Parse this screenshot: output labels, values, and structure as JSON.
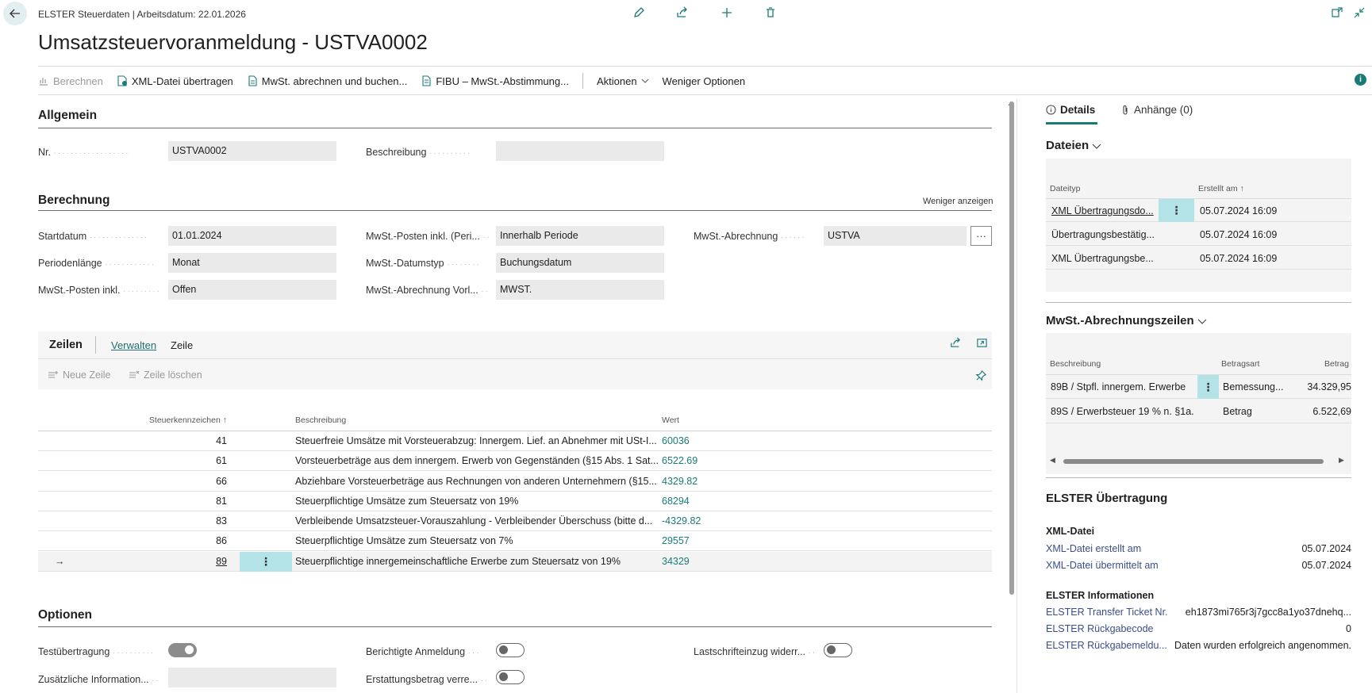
{
  "header": {
    "breadcrumb": "ELSTER Steuerdaten | Arbeitsdatum: 22.01.2026",
    "title": "Umsatzsteuervoranmeldung - USTVA0002"
  },
  "toolbar": {
    "berechnen": "Berechnen",
    "xml_uebertragen": "XML-Datei übertragen",
    "mwst_abrechnen": "MwSt. abrechnen und buchen...",
    "fibu": "FIBU – MwSt.-Abstimmung...",
    "aktionen": "Aktionen",
    "weniger_optionen": "Weniger Optionen"
  },
  "allgemein": {
    "title": "Allgemein",
    "nr_label": "Nr.",
    "nr_value": "USTVA0002",
    "beschreibung_label": "Beschreibung",
    "beschreibung_value": ""
  },
  "berechnung": {
    "title": "Berechnung",
    "weniger_anzeigen": "Weniger anzeigen",
    "startdatum_label": "Startdatum",
    "startdatum_value": "01.01.2024",
    "periodenlaenge_label": "Periodenlänge",
    "periodenlaenge_value": "Monat",
    "posten_inkl_label": "MwSt.-Posten inkl.",
    "posten_inkl_value": "Offen",
    "posten_peri_label": "MwSt.-Posten inkl. (Peri...",
    "posten_peri_value": "Innerhalb Periode",
    "datumstyp_label": "MwSt.-Datumstyp",
    "datumstyp_value": "Buchungsdatum",
    "abrechnung_vorl_label": "MwSt.-Abrechnung Vorl...",
    "abrechnung_vorl_value": "MWST.",
    "abrechnung_label": "MwSt.-Abrechnung",
    "abrechnung_value": "USTVA"
  },
  "zeilen": {
    "title": "Zeilen",
    "tab_verwalten": "Verwalten",
    "tab_zeile": "Zeile",
    "neue_zeile": "Neue Zeile",
    "zeile_loeschen": "Zeile löschen",
    "col_kennzeichen": "Steuerkennzeichen ↑",
    "col_beschreibung": "Beschreibung",
    "col_wert": "Wert",
    "rows": [
      {
        "code": "41",
        "desc": "Steuerfreie Umsätze mit Vorsteuerabzug: Innergem. Lief. an Abnehmer mit USt-I...",
        "value": "60036"
      },
      {
        "code": "61",
        "desc": "Vorsteuerbeträge aus dem innergem. Erwerb von Gegenständen (§15 Abs. 1 Sat...",
        "value": "6522.69"
      },
      {
        "code": "66",
        "desc": "Abziehbare Vorsteuerbeträge aus Rechnungen von anderen Unternehmern (§15...",
        "value": "4329.82"
      },
      {
        "code": "81",
        "desc": "Steuerpflichtige Umsätze zum Steuersatz von 19%",
        "value": "68294"
      },
      {
        "code": "83",
        "desc": "Verbleibende Umsatzsteuer-Vorauszahlung - Verbleibender Überschuss (bitte d...",
        "value": "-4329.82"
      },
      {
        "code": "86",
        "desc": "Steuerpflichtige Umsätze zum Steuersatz von 7%",
        "value": "29557"
      },
      {
        "code": "89",
        "desc": "Steuerpflichtige innergemeinschaftliche Erwerbe zum Steuersatz von 19%",
        "value": "34329"
      }
    ]
  },
  "optionen": {
    "title": "Optionen",
    "testuebertragung": "Testübertragung",
    "zusaetzliche": "Zusätzliche Information...",
    "berichtigte": "Berichtigte Anmeldung",
    "erstattung": "Erstattungsbetrag verre...",
    "lastschrift": "Lastschrifteinzug widerr..."
  },
  "factbox": {
    "tab_details": "Details",
    "tab_anhaenge": "Anhänge (0)",
    "dateien_title": "Dateien",
    "dateien_col_typ": "Dateityp",
    "dateien_col_erstellt": "Erstellt am ↑",
    "dateien": [
      {
        "typ": "XML Übertragungsdo...",
        "erstellt": "05.07.2024 16:09"
      },
      {
        "typ": "Übertragungsbestätig...",
        "erstellt": "05.07.2024 16:09"
      },
      {
        "typ": "XML Übertragungsbe...",
        "erstellt": "05.07.2024 16:09"
      }
    ],
    "abrechnung_title": "MwSt.-Abrechnungszeilen",
    "abr_col_beschreibung": "Beschreibung",
    "abr_col_betragsart": "Betragsart",
    "abr_col_betrag": "Betrag",
    "abr_rows": [
      {
        "beschreibung": "89B / Stpfl. innergem. Erwerbe ...",
        "betragsart": "Bemessung...",
        "betrag": "34.329,95"
      },
      {
        "beschreibung": "89S / Erwerbsteuer 19 % n. §1a...",
        "betragsart": "Betrag",
        "betrag": "6.522,69"
      }
    ],
    "elster_title": "ELSTER Übertragung",
    "xml_datei_title": "XML-Datei",
    "xml_erstellt_label": "XML-Datei erstellt am",
    "xml_erstellt_value": "05.07.2024",
    "xml_uebermittelt_label": "XML-Datei übermittelt am",
    "xml_uebermittelt_value": "05.07.2024",
    "elster_info_title": "ELSTER Informationen",
    "ticket_label": "ELSTER Transfer Ticket Nr.",
    "ticket_value": "eh1873mi765r3j7gcc8a1yo37dnehq...",
    "rueckgabecode_label": "ELSTER Rückgabecode",
    "rueckgabecode_value": "0",
    "rueckgabemeld_label": "ELSTER Rückgabemeldu...",
    "rueckgabemeld_value": "Daten wurden erfolgreich angenommen."
  },
  "colors": {
    "accent": "#1a7a78",
    "selection": "#b3e3e7"
  }
}
